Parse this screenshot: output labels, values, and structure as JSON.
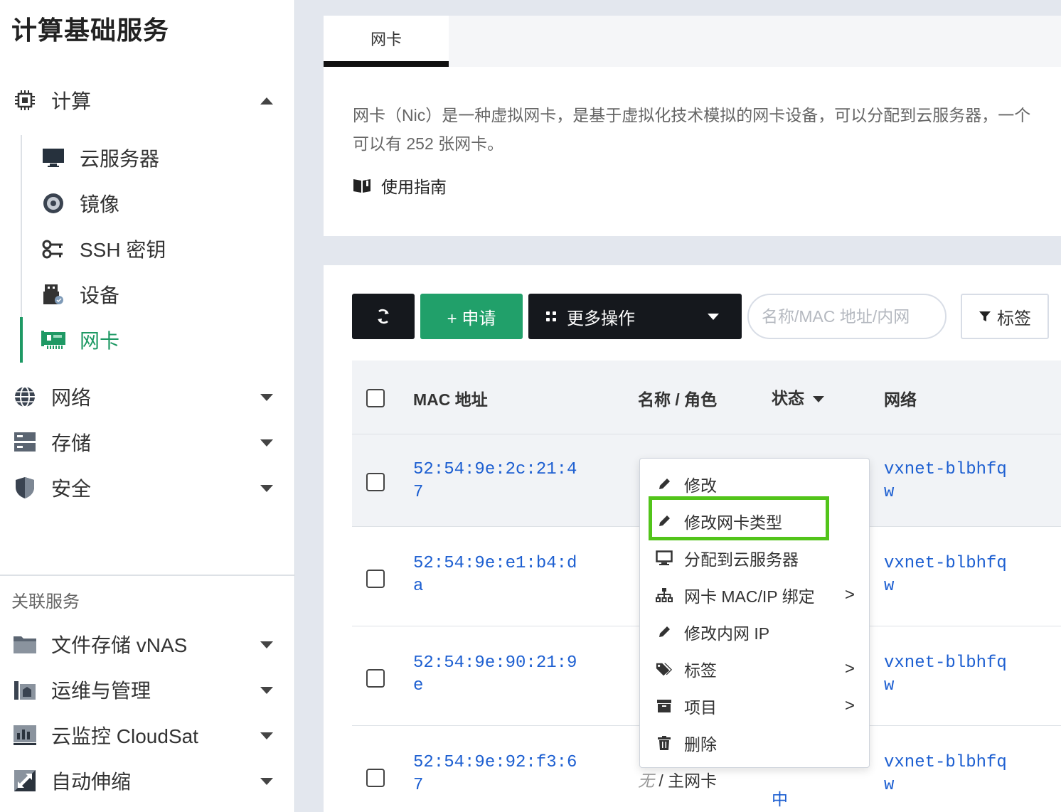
{
  "sidebar": {
    "title": "计算基础服务",
    "groups": [
      {
        "label": "计算",
        "icon": "cpu-icon"
      },
      {
        "label": "网络",
        "icon": "globe-icon"
      },
      {
        "label": "存储",
        "icon": "storage-icon"
      },
      {
        "label": "安全",
        "icon": "shield-icon"
      }
    ],
    "compute_items": [
      {
        "label": "云服务器",
        "icon": "monitor-icon"
      },
      {
        "label": "镜像",
        "icon": "disc-icon"
      },
      {
        "label": "SSH 密钥",
        "icon": "key-icon"
      },
      {
        "label": "设备",
        "icon": "usb-device-icon"
      },
      {
        "label": "网卡",
        "icon": "nic-icon",
        "active": true
      }
    ],
    "related_title": "关联服务",
    "related": [
      {
        "label": "文件存储 vNAS",
        "icon": "folder-icon"
      },
      {
        "label": "运维与管理",
        "icon": "ops-icon"
      },
      {
        "label": "云监控 CloudSat",
        "icon": "chart-icon"
      },
      {
        "label": "自动伸缩",
        "icon": "resize-icon"
      }
    ]
  },
  "tabs": [
    "网卡"
  ],
  "info": {
    "line1": "网卡（Nic）是一种虚拟网卡，是基于虚拟化技术模拟的网卡设备，可以分配到云服务器，一个",
    "line2": "可以有 252 张网卡。",
    "guide": "使用指南"
  },
  "toolbar": {
    "apply": "+ 申请",
    "more": "更多操作",
    "search_placeholder": "名称/MAC 地址/内网",
    "tag": "标签"
  },
  "table": {
    "headers": {
      "mac": "MAC 地址",
      "name_role": "名称 / 角色",
      "status": "状态",
      "network": "网络"
    },
    "rows": [
      {
        "mac": "52:54:9e:2c:21:47",
        "network": "vxnet-blbhfqw"
      },
      {
        "mac": "52:54:9e:e1:b4:da",
        "network": "vxnet-blbhfqw"
      },
      {
        "mac": "52:54:9e:90:21:9e",
        "network": "vxnet-blbhfqw"
      },
      {
        "mac": "52:54:9e:92:f3:67",
        "name": "无",
        "role": "主网卡",
        "status": "中",
        "network": "vxnet-blbhfqw"
      }
    ]
  },
  "menu": {
    "items": [
      {
        "label": "修改",
        "icon": "pencil-icon"
      },
      {
        "label": "修改网卡类型",
        "icon": "pencil-icon"
      },
      {
        "label": "分配到云服务器",
        "icon": "monitor-icon"
      },
      {
        "label": "网卡 MAC/IP 绑定",
        "icon": "sitemap-icon",
        "submenu": ">"
      },
      {
        "label": "修改内网 IP",
        "icon": "pencil-icon"
      },
      {
        "label": "标签",
        "icon": "tags-icon",
        "submenu": ">"
      },
      {
        "label": "项目",
        "icon": "archive-icon",
        "submenu": ">"
      },
      {
        "label": "删除",
        "icon": "trash-icon"
      }
    ]
  },
  "colors": {
    "accent": "#21a06a",
    "link": "#1d5fd1",
    "dark": "#15181d",
    "highlight": "#52c41a"
  }
}
